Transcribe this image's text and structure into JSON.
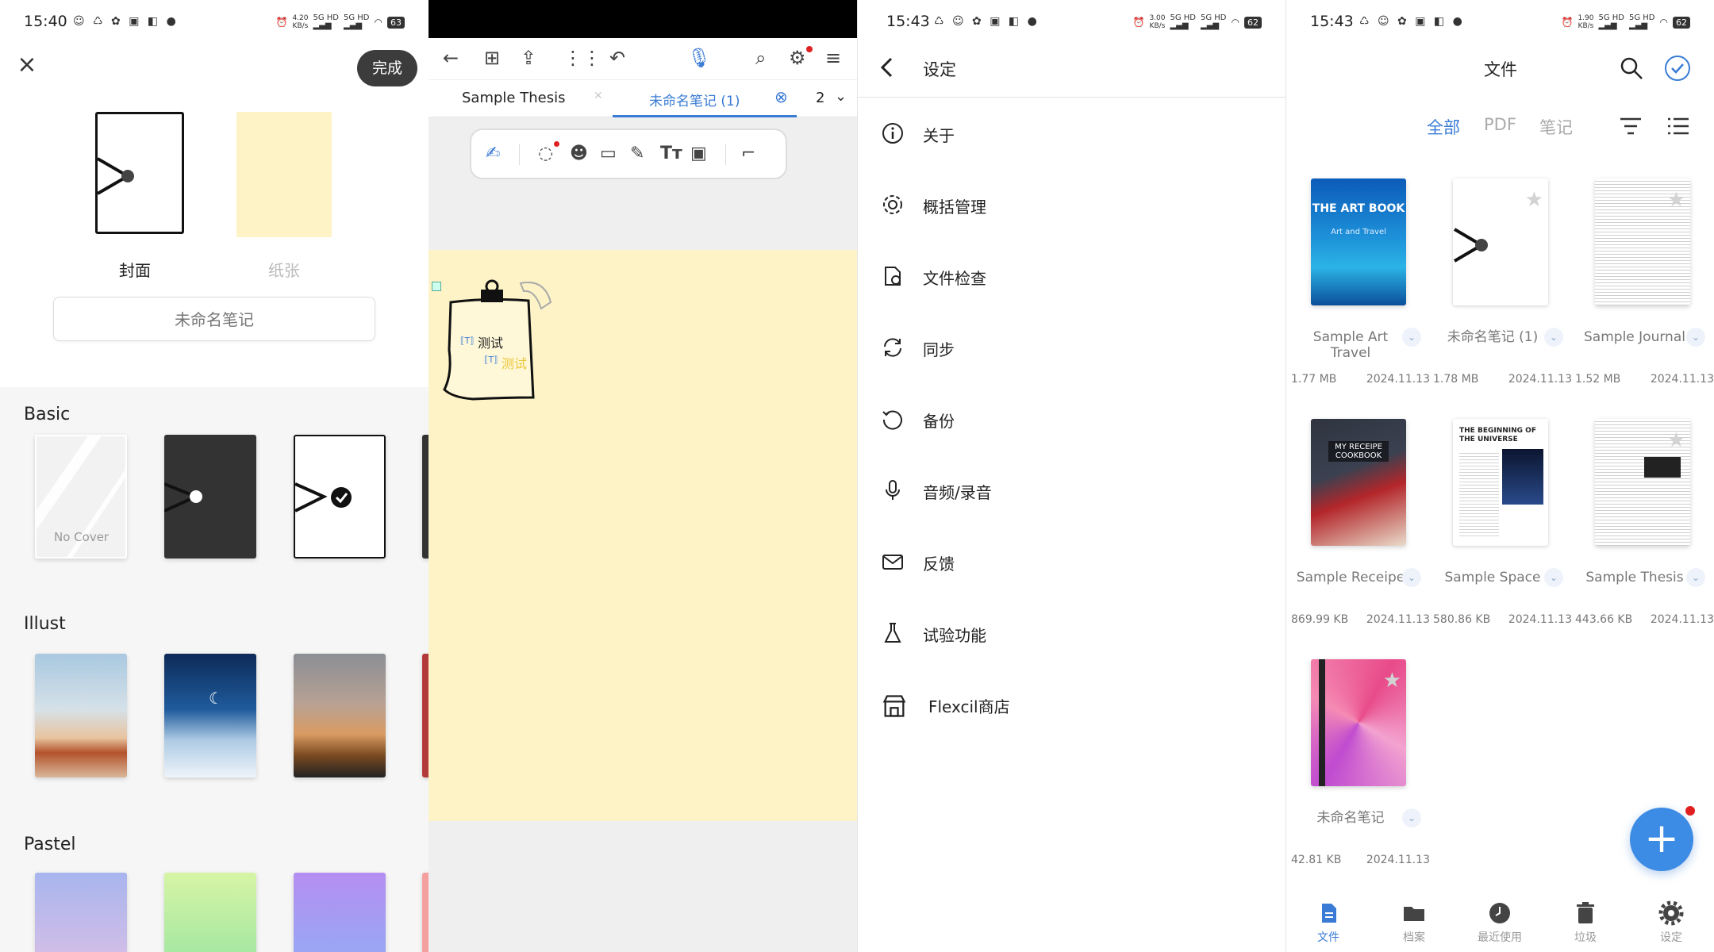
{
  "colors": {
    "accent": "#3a7bd5",
    "fab": "#3c8be4",
    "paper": "#fdf3c6",
    "dark": "#3c3c3c"
  },
  "status_bars": [
    {
      "time": "15:40",
      "speed_value": "4.20",
      "speed_unit": "KB/s",
      "battery": "63"
    },
    {
      "time": "15:43",
      "speed_value": "3.00",
      "speed_unit": "KB/s",
      "battery": "62"
    },
    {
      "time": "15:43",
      "speed_value": "1.90",
      "speed_unit": "KB/s",
      "battery": "62"
    }
  ],
  "network": {
    "label": "5G HD"
  },
  "new_note": {
    "done_label": "完成",
    "tabs": {
      "cover": "封面",
      "paper": "纸张"
    },
    "name_value": "未命名笔记",
    "sections": {
      "basic": "Basic",
      "illust": "Illust",
      "pastel": "Pastel"
    },
    "no_cover_label": "No Cover"
  },
  "editor": {
    "tabs": [
      {
        "label": "Sample Thesis"
      },
      {
        "label": "未命名笔记 (1)"
      }
    ],
    "page_number": "2",
    "canvas_texts": {
      "text1": "测试",
      "text2": "测试"
    }
  },
  "settings": {
    "title": "设定",
    "items": [
      {
        "label": "关于",
        "icon": "info-icon"
      },
      {
        "label": "概括管理",
        "icon": "gear-icon"
      },
      {
        "label": "文件检查",
        "icon": "file-check-icon"
      },
      {
        "label": "同步",
        "icon": "sync-icon"
      },
      {
        "label": "备份",
        "icon": "backup-icon"
      },
      {
        "label": "音频/录音",
        "icon": "microphone-icon"
      },
      {
        "label": "反馈",
        "icon": "mail-icon"
      },
      {
        "label": "试验功能",
        "icon": "flask-icon"
      },
      {
        "label": "Flexcil商店",
        "icon": "store-icon"
      }
    ]
  },
  "files": {
    "title": "文件",
    "filters": [
      {
        "label": "全部"
      },
      {
        "label": "PDF"
      },
      {
        "label": "笔记"
      }
    ],
    "items": [
      {
        "name": "Sample Art Travel",
        "size": "1.77 MB",
        "date": "2024.11.13",
        "cover_title": "THE ART BOOK",
        "cover_sub": "Art and Travel"
      },
      {
        "name": "未命名笔记 (1)",
        "size": "1.78 MB",
        "date": "2024.11.13"
      },
      {
        "name": "Sample Journal",
        "size": "1.52 MB",
        "date": "2024.11.13"
      },
      {
        "name": "Sample Receipe",
        "size": "869.99 KB",
        "date": "2024.11.13",
        "cover_title": "MY RECEIPE COOKBOOK"
      },
      {
        "name": "Sample Space",
        "size": "580.86 KB",
        "date": "2024.11.13",
        "cover_title": "THE BEGINNING OF THE UNIVERSE"
      },
      {
        "name": "Sample Thesis",
        "size": "443.66 KB",
        "date": "2024.11.13"
      },
      {
        "name": "未命名笔记",
        "size": "42.81 KB",
        "date": "2024.11.13"
      }
    ],
    "bottom_nav": [
      {
        "label": "文件",
        "icon": "file-icon",
        "active": true
      },
      {
        "label": "档案",
        "icon": "folder-icon"
      },
      {
        "label": "最近使用",
        "icon": "clock-icon"
      },
      {
        "label": "垃圾",
        "icon": "trash-icon"
      },
      {
        "label": "设定",
        "icon": "settings-gear-icon"
      }
    ]
  }
}
